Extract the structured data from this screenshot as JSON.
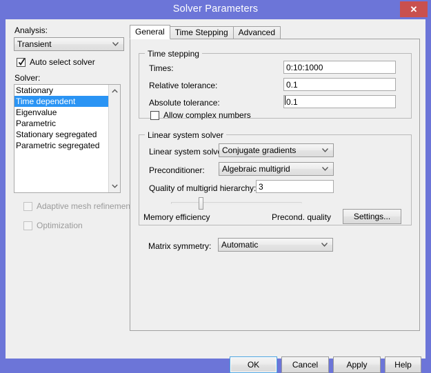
{
  "window": {
    "title": "Solver Parameters",
    "close_label": "✕",
    "titlebar_color": "#6c75d8",
    "close_color": "#c9504e",
    "selection_color": "#2a94f4"
  },
  "left_panel": {
    "analysis_label": "Analysis:",
    "analysis_value": "Transient",
    "analysis_options": [
      "Transient"
    ],
    "auto_select_solver": {
      "label": "Auto select solver",
      "checked": true
    },
    "solver_label": "Solver:",
    "solver_items": [
      "Stationary",
      "Time dependent",
      "Eigenvalue",
      "Parametric",
      "Stationary segregated",
      "Parametric segregated"
    ],
    "solver_selected_index": 1,
    "adaptive_mesh_refinement": {
      "label": "Adaptive mesh refinement",
      "checked": false,
      "disabled": true
    },
    "optimization": {
      "label": "Optimization",
      "checked": false,
      "disabled": true
    }
  },
  "tabs": [
    {
      "label": "General",
      "active": true
    },
    {
      "label": "Time Stepping",
      "active": false
    },
    {
      "label": "Advanced",
      "active": false
    }
  ],
  "general_tab": {
    "time_stepping": {
      "group_title": "Time stepping",
      "times_label": "Times:",
      "times_value": "0:10:1000",
      "relative_tolerance_label": "Relative tolerance:",
      "relative_tolerance_value": "0.1",
      "absolute_tolerance_label": "Absolute tolerance:",
      "absolute_tolerance_value": "0.1",
      "absolute_tolerance_focused": true,
      "allow_complex_numbers": {
        "label": "Allow complex numbers",
        "checked": false
      }
    },
    "linear_system_solver": {
      "group_title": "Linear system solver",
      "solver_label": "Linear system solver:",
      "solver_value": "Conjugate gradients",
      "preconditioner_label": "Preconditioner:",
      "preconditioner_value": "Algebraic multigrid",
      "quality_label": "Quality of multigrid hierarchy:",
      "quality_value": "3",
      "slider": {
        "left_label": "Memory efficiency",
        "right_label": "Precond. quality",
        "value": 22,
        "min": 0,
        "max": 100
      },
      "settings_button": "Settings..."
    },
    "matrix_symmetry_label": "Matrix symmetry:",
    "matrix_symmetry_value": "Automatic"
  },
  "footer": {
    "ok": "OK",
    "cancel": "Cancel",
    "apply": "Apply",
    "help": "Help"
  }
}
